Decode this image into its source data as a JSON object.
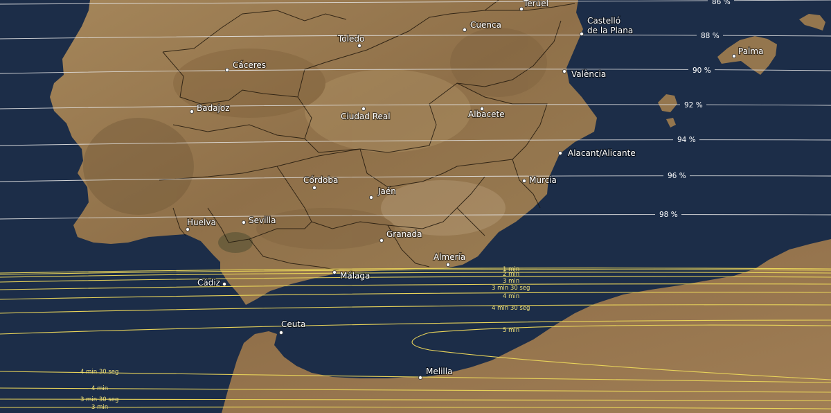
{
  "map": {
    "colors": {
      "sea": "#1c2d48",
      "land": "#9b7a50",
      "land_dark": "#6e5535",
      "land_light": "#b9996a",
      "borders": "#1a1208",
      "obscuration_line": "#e6e6e6",
      "duration_line": "#e8d35a",
      "city_dot": "#ffffff"
    },
    "cities": [
      {
        "id": "teruel",
        "name": "Teruel"
      },
      {
        "id": "cuenca",
        "name": "Cuenca"
      },
      {
        "id": "castello",
        "name": "Castelló\nde la Plana"
      },
      {
        "id": "toledo",
        "name": "Toledo"
      },
      {
        "id": "caceres",
        "name": "Cáceres"
      },
      {
        "id": "valencia",
        "name": "València"
      },
      {
        "id": "palma",
        "name": "Palma"
      },
      {
        "id": "badajoz",
        "name": "Badajoz"
      },
      {
        "id": "ciudad_real",
        "name": "Ciudad Real"
      },
      {
        "id": "albacete",
        "name": "Albacete"
      },
      {
        "id": "alicante",
        "name": "Alacant/Alicante"
      },
      {
        "id": "cordoba",
        "name": "Córdoba"
      },
      {
        "id": "murcia",
        "name": "Murcia"
      },
      {
        "id": "jaen",
        "name": "Jaén"
      },
      {
        "id": "huelva",
        "name": "Huelva"
      },
      {
        "id": "sevilla",
        "name": "Sevilla"
      },
      {
        "id": "granada",
        "name": "Granada"
      },
      {
        "id": "almeria",
        "name": "Almería"
      },
      {
        "id": "malaga",
        "name": "Málaga"
      },
      {
        "id": "cadiz",
        "name": "Cádiz"
      },
      {
        "id": "ceuta",
        "name": "Ceuta"
      },
      {
        "id": "melilla",
        "name": "Melilla"
      }
    ],
    "obscuration_lines": [
      {
        "id": "p86",
        "label": "86 %"
      },
      {
        "id": "p88",
        "label": "88 %"
      },
      {
        "id": "p90",
        "label": "90 %"
      },
      {
        "id": "p92",
        "label": "92 %"
      },
      {
        "id": "p94",
        "label": "94 %"
      },
      {
        "id": "p96",
        "label": "96 %"
      },
      {
        "id": "p98",
        "label": "98 %"
      }
    ],
    "totality_duration_lines": [
      {
        "id": "n1",
        "label": "1 min"
      },
      {
        "id": "n2",
        "label": "2 min"
      },
      {
        "id": "n3",
        "label": "3 min"
      },
      {
        "id": "n35",
        "label": "3 min 30 seg"
      },
      {
        "id": "n4",
        "label": "4 min"
      },
      {
        "id": "n45",
        "label": "4 min 30 seg"
      },
      {
        "id": "c5",
        "label": "5 min"
      },
      {
        "id": "s45",
        "label": "4 min 30 seg"
      },
      {
        "id": "s4",
        "label": "4 min"
      },
      {
        "id": "s35",
        "label": "3 min 30 seg"
      },
      {
        "id": "s3",
        "label": "3 min"
      }
    ]
  }
}
